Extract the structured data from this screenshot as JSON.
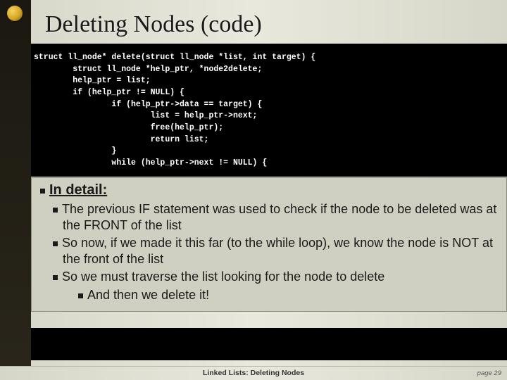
{
  "title": "Deleting Nodes (code)",
  "code": "struct ll_node* delete(struct ll_node *list, int target) {\n        struct ll_node *help_ptr, *node2delete;\n        help_ptr = list;\n        if (help_ptr != NULL) {\n                if (help_ptr->data == target) {\n                        list = help_ptr->next;\n                        free(help_ptr);\n                        return list;\n                }\n                while (help_ptr->next != NULL) {",
  "explain": {
    "heading": "In detail:",
    "bullets": [
      "The previous IF statement was used to check if the node to be deleted was at the FRONT of the list",
      "So now, if we made it this far (to the while loop), we know the node is NOT at the front of the list",
      "So we must traverse the list looking for the node to delete"
    ],
    "sub_bullet": "And then we delete it!"
  },
  "footer": {
    "title": "Linked Lists:  Deleting Nodes",
    "page_label": "page 29"
  }
}
